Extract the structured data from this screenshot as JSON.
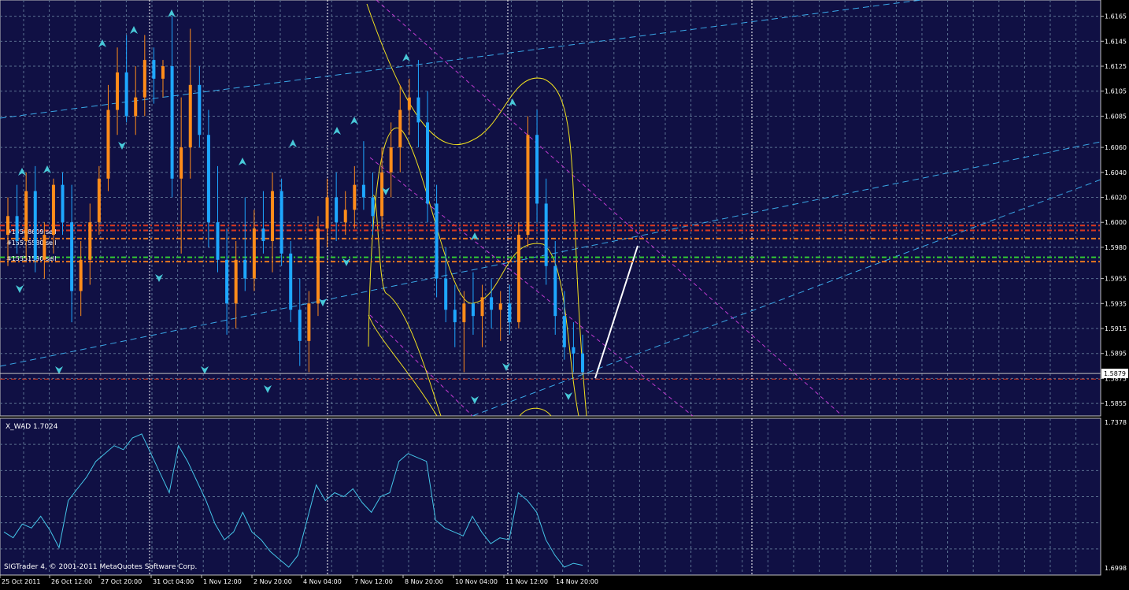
{
  "app": {
    "copyright": "SIGTrader 4, © 2001-2011 MetaQuotes Software Corp."
  },
  "colors": {
    "background": "#000000",
    "plot_bg": "#101044",
    "grid": "#5a6f8f",
    "axis_text": "#ffffff",
    "bull_candle": "#ff8c1a",
    "bear_candle": "#1ea7ff",
    "channel_blue": "#3aa8e8",
    "channel_magenta": "#c23bd3",
    "regression_yellow": "#f0e020",
    "order_red": "#d83a20",
    "order_orange": "#e87820",
    "order_green": "#33cc33",
    "indicator_line": "#45c5e8",
    "fractal_arrow": "#48c8d8",
    "trend_white": "#ffffff"
  },
  "price_axis": {
    "labels": [
      "1.6165",
      "1.6145",
      "1.6125",
      "1.6105",
      "1.6085",
      "1.6060",
      "1.6040",
      "1.6020",
      "1.6000",
      "1.5980",
      "1.5955",
      "1.5935",
      "1.5915",
      "1.5895",
      "1.5875",
      "1.5855"
    ],
    "current_price": "1.5879"
  },
  "indicator": {
    "label": "X_WAD 1.7024",
    "axis_labels": [
      "1.7378",
      "1.6998"
    ]
  },
  "time_axis": {
    "labels": [
      "25 Oct 2011",
      "26 Oct 12:00",
      "27 Oct 20:00",
      "31 Oct 04:00",
      "1 Nov 12:00",
      "2 Nov 20:00",
      "4 Nov 04:00",
      "7 Nov 12:00",
      "8 Nov 20:00",
      "10 Nov 04:00",
      "11 Nov 12:00",
      "14 Nov 20:00"
    ]
  },
  "orders": [
    {
      "label": "#15568609 sell"
    },
    {
      "label": "#15575580 sell"
    },
    {
      "label": "#15551590 sell"
    }
  ],
  "chart_data": {
    "type": "candlestick",
    "symbol_timeframe": "",
    "ylim": [
      1.5845,
      1.6178
    ],
    "indicator_ylim": [
      1.699,
      1.739
    ],
    "candles": [
      {
        "o": 1.599,
        "h": 1.602,
        "l": 1.5965,
        "c": 1.6005
      },
      {
        "o": 1.6005,
        "h": 1.603,
        "l": 1.5975,
        "c": 1.5985
      },
      {
        "o": 1.5985,
        "h": 1.604,
        "l": 1.597,
        "c": 1.6025
      },
      {
        "o": 1.6025,
        "h": 1.6045,
        "l": 1.596,
        "c": 1.597
      },
      {
        "o": 1.597,
        "h": 1.6,
        "l": 1.5955,
        "c": 1.599
      },
      {
        "o": 1.599,
        "h": 1.6035,
        "l": 1.5975,
        "c": 1.603
      },
      {
        "o": 1.603,
        "h": 1.604,
        "l": 1.599,
        "c": 1.6
      },
      {
        "o": 1.6,
        "h": 1.603,
        "l": 1.592,
        "c": 1.5945
      },
      {
        "o": 1.5945,
        "h": 1.5985,
        "l": 1.5925,
        "c": 1.597
      },
      {
        "o": 1.597,
        "h": 1.6015,
        "l": 1.595,
        "c": 1.6
      },
      {
        "o": 1.6,
        "h": 1.6045,
        "l": 1.599,
        "c": 1.6035
      },
      {
        "o": 1.6035,
        "h": 1.611,
        "l": 1.6025,
        "c": 1.609
      },
      {
        "o": 1.609,
        "h": 1.614,
        "l": 1.607,
        "c": 1.612
      },
      {
        "o": 1.612,
        "h": 1.615,
        "l": 1.608,
        "c": 1.6085
      },
      {
        "o": 1.6085,
        "h": 1.6125,
        "l": 1.607,
        "c": 1.61
      },
      {
        "o": 1.61,
        "h": 1.615,
        "l": 1.6085,
        "c": 1.613
      },
      {
        "o": 1.613,
        "h": 1.614,
        "l": 1.6095,
        "c": 1.6115
      },
      {
        "o": 1.6115,
        "h": 1.613,
        "l": 1.61,
        "c": 1.6125
      },
      {
        "o": 1.6125,
        "h": 1.6165,
        "l": 1.602,
        "c": 1.6035
      },
      {
        "o": 1.6035,
        "h": 1.61,
        "l": 1.5975,
        "c": 1.606
      },
      {
        "o": 1.606,
        "h": 1.6155,
        "l": 1.6035,
        "c": 1.611
      },
      {
        "o": 1.611,
        "h": 1.6125,
        "l": 1.606,
        "c": 1.607
      },
      {
        "o": 1.607,
        "h": 1.609,
        "l": 1.598,
        "c": 1.6
      },
      {
        "o": 1.6,
        "h": 1.6045,
        "l": 1.596,
        "c": 1.597
      },
      {
        "o": 1.597,
        "h": 1.5995,
        "l": 1.591,
        "c": 1.5935
      },
      {
        "o": 1.5935,
        "h": 1.5985,
        "l": 1.5915,
        "c": 1.597
      },
      {
        "o": 1.597,
        "h": 1.602,
        "l": 1.5945,
        "c": 1.5955
      },
      {
        "o": 1.5955,
        "h": 1.601,
        "l": 1.5945,
        "c": 1.5995
      },
      {
        "o": 1.5995,
        "h": 1.6025,
        "l": 1.5975,
        "c": 1.5985
      },
      {
        "o": 1.5985,
        "h": 1.604,
        "l": 1.596,
        "c": 1.6025
      },
      {
        "o": 1.6025,
        "h": 1.6035,
        "l": 1.5965,
        "c": 1.5975
      },
      {
        "o": 1.5975,
        "h": 1.5985,
        "l": 1.592,
        "c": 1.593
      },
      {
        "o": 1.593,
        "h": 1.5955,
        "l": 1.5885,
        "c": 1.5905
      },
      {
        "o": 1.5905,
        "h": 1.5945,
        "l": 1.588,
        "c": 1.5935
      },
      {
        "o": 1.5935,
        "h": 1.6005,
        "l": 1.5925,
        "c": 1.5995
      },
      {
        "o": 1.5995,
        "h": 1.6035,
        "l": 1.598,
        "c": 1.602
      },
      {
        "o": 1.602,
        "h": 1.604,
        "l": 1.5985,
        "c": 1.6
      },
      {
        "o": 1.6,
        "h": 1.6025,
        "l": 1.599,
        "c": 1.601
      },
      {
        "o": 1.601,
        "h": 1.6045,
        "l": 1.5995,
        "c": 1.603
      },
      {
        "o": 1.603,
        "h": 1.6065,
        "l": 1.601,
        "c": 1.602
      },
      {
        "o": 1.602,
        "h": 1.604,
        "l": 1.599,
        "c": 1.6005
      },
      {
        "o": 1.6005,
        "h": 1.606,
        "l": 1.5995,
        "c": 1.604
      },
      {
        "o": 1.604,
        "h": 1.608,
        "l": 1.602,
        "c": 1.606
      },
      {
        "o": 1.606,
        "h": 1.611,
        "l": 1.604,
        "c": 1.609
      },
      {
        "o": 1.609,
        "h": 1.6115,
        "l": 1.607,
        "c": 1.61
      },
      {
        "o": 1.61,
        "h": 1.613,
        "l": 1.606,
        "c": 1.608
      },
      {
        "o": 1.608,
        "h": 1.6105,
        "l": 1.6,
        "c": 1.6015
      },
      {
        "o": 1.6015,
        "h": 1.603,
        "l": 1.594,
        "c": 1.5955
      },
      {
        "o": 1.5955,
        "h": 1.598,
        "l": 1.592,
        "c": 1.593
      },
      {
        "o": 1.593,
        "h": 1.595,
        "l": 1.59,
        "c": 1.592
      },
      {
        "o": 1.592,
        "h": 1.5945,
        "l": 1.588,
        "c": 1.5935
      },
      {
        "o": 1.5935,
        "h": 1.596,
        "l": 1.591,
        "c": 1.5925
      },
      {
        "o": 1.5925,
        "h": 1.595,
        "l": 1.59,
        "c": 1.594
      },
      {
        "o": 1.594,
        "h": 1.5955,
        "l": 1.5915,
        "c": 1.593
      },
      {
        "o": 1.593,
        "h": 1.5945,
        "l": 1.5905,
        "c": 1.5935
      },
      {
        "o": 1.5935,
        "h": 1.595,
        "l": 1.591,
        "c": 1.592
      },
      {
        "o": 1.592,
        "h": 1.6,
        "l": 1.5915,
        "c": 1.599
      },
      {
        "o": 1.599,
        "h": 1.6085,
        "l": 1.598,
        "c": 1.607
      },
      {
        "o": 1.607,
        "h": 1.609,
        "l": 1.6,
        "c": 1.6015
      },
      {
        "o": 1.6015,
        "h": 1.6035,
        "l": 1.595,
        "c": 1.5965
      },
      {
        "o": 1.5965,
        "h": 1.5985,
        "l": 1.591,
        "c": 1.5925
      },
      {
        "o": 1.5925,
        "h": 1.5945,
        "l": 1.589,
        "c": 1.59
      },
      {
        "o": 1.59,
        "h": 1.592,
        "l": 1.588,
        "c": 1.5895
      },
      {
        "o": 1.5895,
        "h": 1.591,
        "l": 1.5878,
        "c": 1.588
      }
    ],
    "indicator_values": [
      1.71,
      1.7085,
      1.712,
      1.711,
      1.714,
      1.7105,
      1.706,
      1.718,
      1.721,
      1.724,
      1.728,
      1.73,
      1.732,
      1.731,
      1.734,
      1.735,
      1.73,
      1.725,
      1.72,
      1.732,
      1.728,
      1.723,
      1.718,
      1.712,
      1.708,
      1.71,
      1.715,
      1.71,
      1.708,
      1.705,
      1.703,
      1.701,
      1.704,
      1.713,
      1.722,
      1.718,
      1.72,
      1.719,
      1.721,
      1.7175,
      1.715,
      1.719,
      1.72,
      1.728,
      1.73,
      1.729,
      1.728,
      1.713,
      1.711,
      1.71,
      1.709,
      1.714,
      1.71,
      1.707,
      1.7085,
      1.708,
      1.72,
      1.718,
      1.715,
      1.708,
      1.704,
      1.701,
      1.702,
      1.7015
    ],
    "order_levels": [
      1.59975,
      1.59935,
      1.5987,
      1.5972,
      1.59685,
      1.58745
    ]
  }
}
